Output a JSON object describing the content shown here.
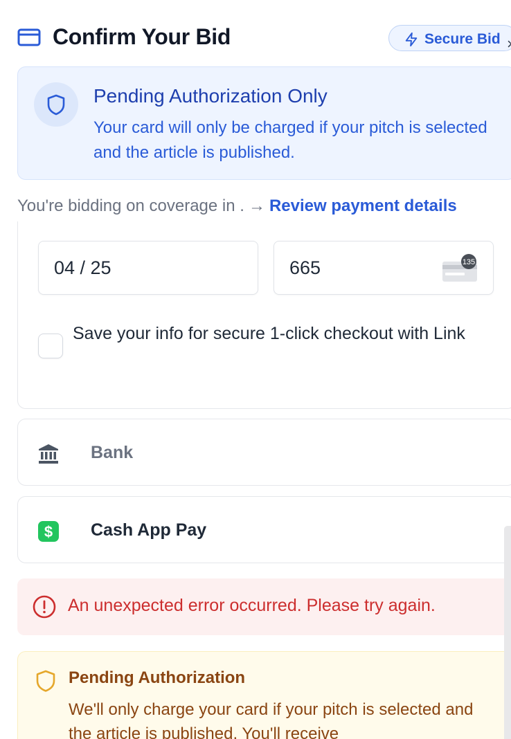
{
  "header": {
    "title": "Confirm Your Bid",
    "secure_badge": "Secure Bid",
    "close_glyph": "×"
  },
  "info_banner": {
    "title": "Pending Authorization Only",
    "text": "Your card will only be charged if your pitch is selected and the article is published."
  },
  "bidding": {
    "text": "You're bidding on coverage in .",
    "arrow": "→",
    "link": "Review payment details"
  },
  "card_form": {
    "expiry_value": "04 / 25",
    "cvc_value": "665",
    "cvc_icon_badge": "135",
    "save_info_label": "Save your info for secure 1-click checkout with Link"
  },
  "payment_methods": [
    {
      "label": "Bank",
      "icon": "bank-icon"
    },
    {
      "label": "Cash App Pay",
      "icon": "cash-app-icon"
    }
  ],
  "error": {
    "text": "An unexpected error occurred. Please try again."
  },
  "warning": {
    "title": "Pending Authorization",
    "text": "We'll only charge your card if your pitch is selected and the article is published. You'll receive"
  },
  "colors": {
    "accent": "#2a5bd7",
    "error": "#cc2e2e",
    "warning": "#8a4512",
    "cash_app_green": "#22c55e"
  }
}
